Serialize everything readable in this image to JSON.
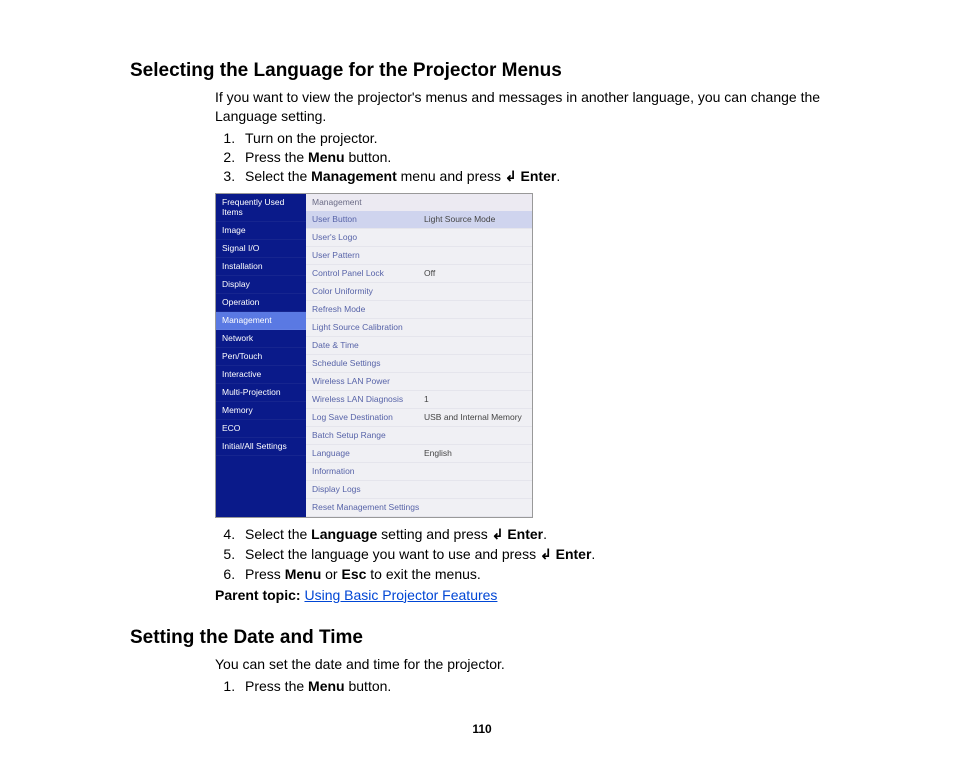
{
  "section1": {
    "heading": "Selecting the Language for the Projector Menus",
    "intro": "If you want to view the projector's menus and messages in another language, you can change the Language setting.",
    "step1": "Turn on the projector.",
    "step2a": "Press the ",
    "step2b": "Menu",
    "step2c": " button.",
    "step3a": "Select the ",
    "step3b": "Management",
    "step3c": " menu and press ",
    "step3d": "Enter",
    "step3e": ".",
    "step4a": "Select the ",
    "step4b": "Language",
    "step4c": " setting and press ",
    "step4d": "Enter",
    "step4e": ".",
    "step5a": "Select the language you want to use and press ",
    "step5b": "Enter",
    "step5c": ".",
    "step6a": "Press ",
    "step6b": "Menu",
    "step6c": " or ",
    "step6d": "Esc",
    "step6e": " to exit the menus.",
    "parent_label": "Parent topic:",
    "parent_link": "Using Basic Projector Features"
  },
  "menu": {
    "sidebar": [
      "Frequently Used Items",
      "Image",
      "Signal I/O",
      "Installation",
      "Display",
      "Operation",
      "Management",
      "Network",
      "Pen/Touch",
      "Interactive",
      "Multi-Projection",
      "Memory",
      "ECO",
      "Initial/All Settings"
    ],
    "sidebar_selected_index": 6,
    "main_header": "Management",
    "options": [
      {
        "label": "User Button",
        "value": "Light Source Mode",
        "sel": true
      },
      {
        "label": "User's Logo",
        "value": ""
      },
      {
        "label": "User Pattern",
        "value": ""
      },
      {
        "label": "Control Panel Lock",
        "value": "Off"
      },
      {
        "label": "Color Uniformity",
        "value": ""
      },
      {
        "label": "Refresh Mode",
        "value": ""
      },
      {
        "label": "Light Source Calibration",
        "value": ""
      },
      {
        "label": "Date & Time",
        "value": ""
      },
      {
        "label": "Schedule Settings",
        "value": ""
      },
      {
        "label": "Wireless LAN Power",
        "value": ""
      },
      {
        "label": "Wireless LAN Diagnosis",
        "value": "1"
      },
      {
        "label": "Log Save Destination",
        "value": "USB and Internal Memory"
      },
      {
        "label": "Batch Setup Range",
        "value": ""
      },
      {
        "label": "Language",
        "value": "English"
      },
      {
        "label": "Information",
        "value": ""
      },
      {
        "label": "Display Logs",
        "value": ""
      },
      {
        "label": "Reset Management Settings",
        "value": ""
      }
    ]
  },
  "section2": {
    "heading": "Setting the Date and Time",
    "intro": "You can set the date and time for the projector.",
    "step1a": "Press the ",
    "step1b": "Menu",
    "step1c": " button."
  },
  "page_number": "110",
  "enter_glyph": "↲"
}
